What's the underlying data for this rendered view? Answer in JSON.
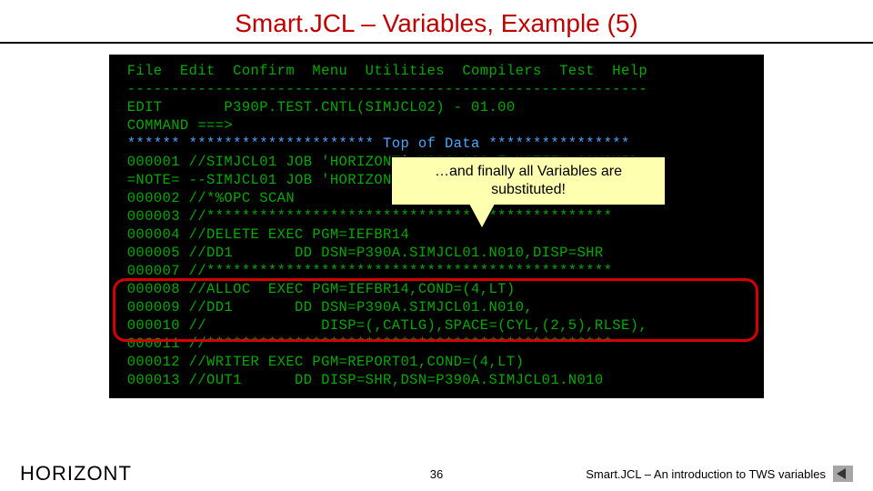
{
  "slide": {
    "title": "Smart.JCL – Variables, Example (5)"
  },
  "terminal": {
    "menu": " File  Edit  Confirm  Menu  Utilities  Compilers  Test  Help",
    "sep": " -----------------------------------------------------------",
    "edit_line": " EDIT       P390P.TEST.CNTL(SIMJCL02) - 01.00",
    "cmd_line": " COMMAND ===>",
    "top": " ****** ********************* Top of Data ****************",
    "l1": " 000001 //SIMJCL01 JOB 'HORIZONT',MSGCLASS=T,NOTIFY=&SYSUID",
    "l_note": " =NOTE= --SIMJCL01 JOB 'HORIZONT'",
    "l2": " 000002 //*%OPC SCAN",
    "l3": " 000003 //**********************************************",
    "l4": " 000004 //DELETE EXEC PGM=IEFBR14",
    "l5": " 000005 //DD1       DD DSN=P390A.SIMJCL01.N010,DISP=SHR",
    "l7": " 000007 //**********************************************",
    "l8": " 000008 //ALLOC  EXEC PGM=IEFBR14,COND=(4,LT)",
    "l9": " 000009 //DD1       DD DSN=P390A.SIMJCL01.N010,",
    "l10": " 000010 //             DISP=(,CATLG),SPACE=(CYL,(2,5),RLSE),",
    "l11": " 000011 //**********************************************",
    "l12": " 000012 //WRITER EXEC PGM=REPORT01,COND=(4,LT)",
    "l13": " 000013 //OUT1      DD DISP=SHR,DSN=P390A.SIMJCL01.N010"
  },
  "callout": {
    "text_line1": "…and finally all Variables are",
    "text_line2": "substituted!"
  },
  "footer": {
    "brand": "HORIZONT",
    "page": "36",
    "right_text": "Smart.JCL – An introduction to TWS variables"
  }
}
